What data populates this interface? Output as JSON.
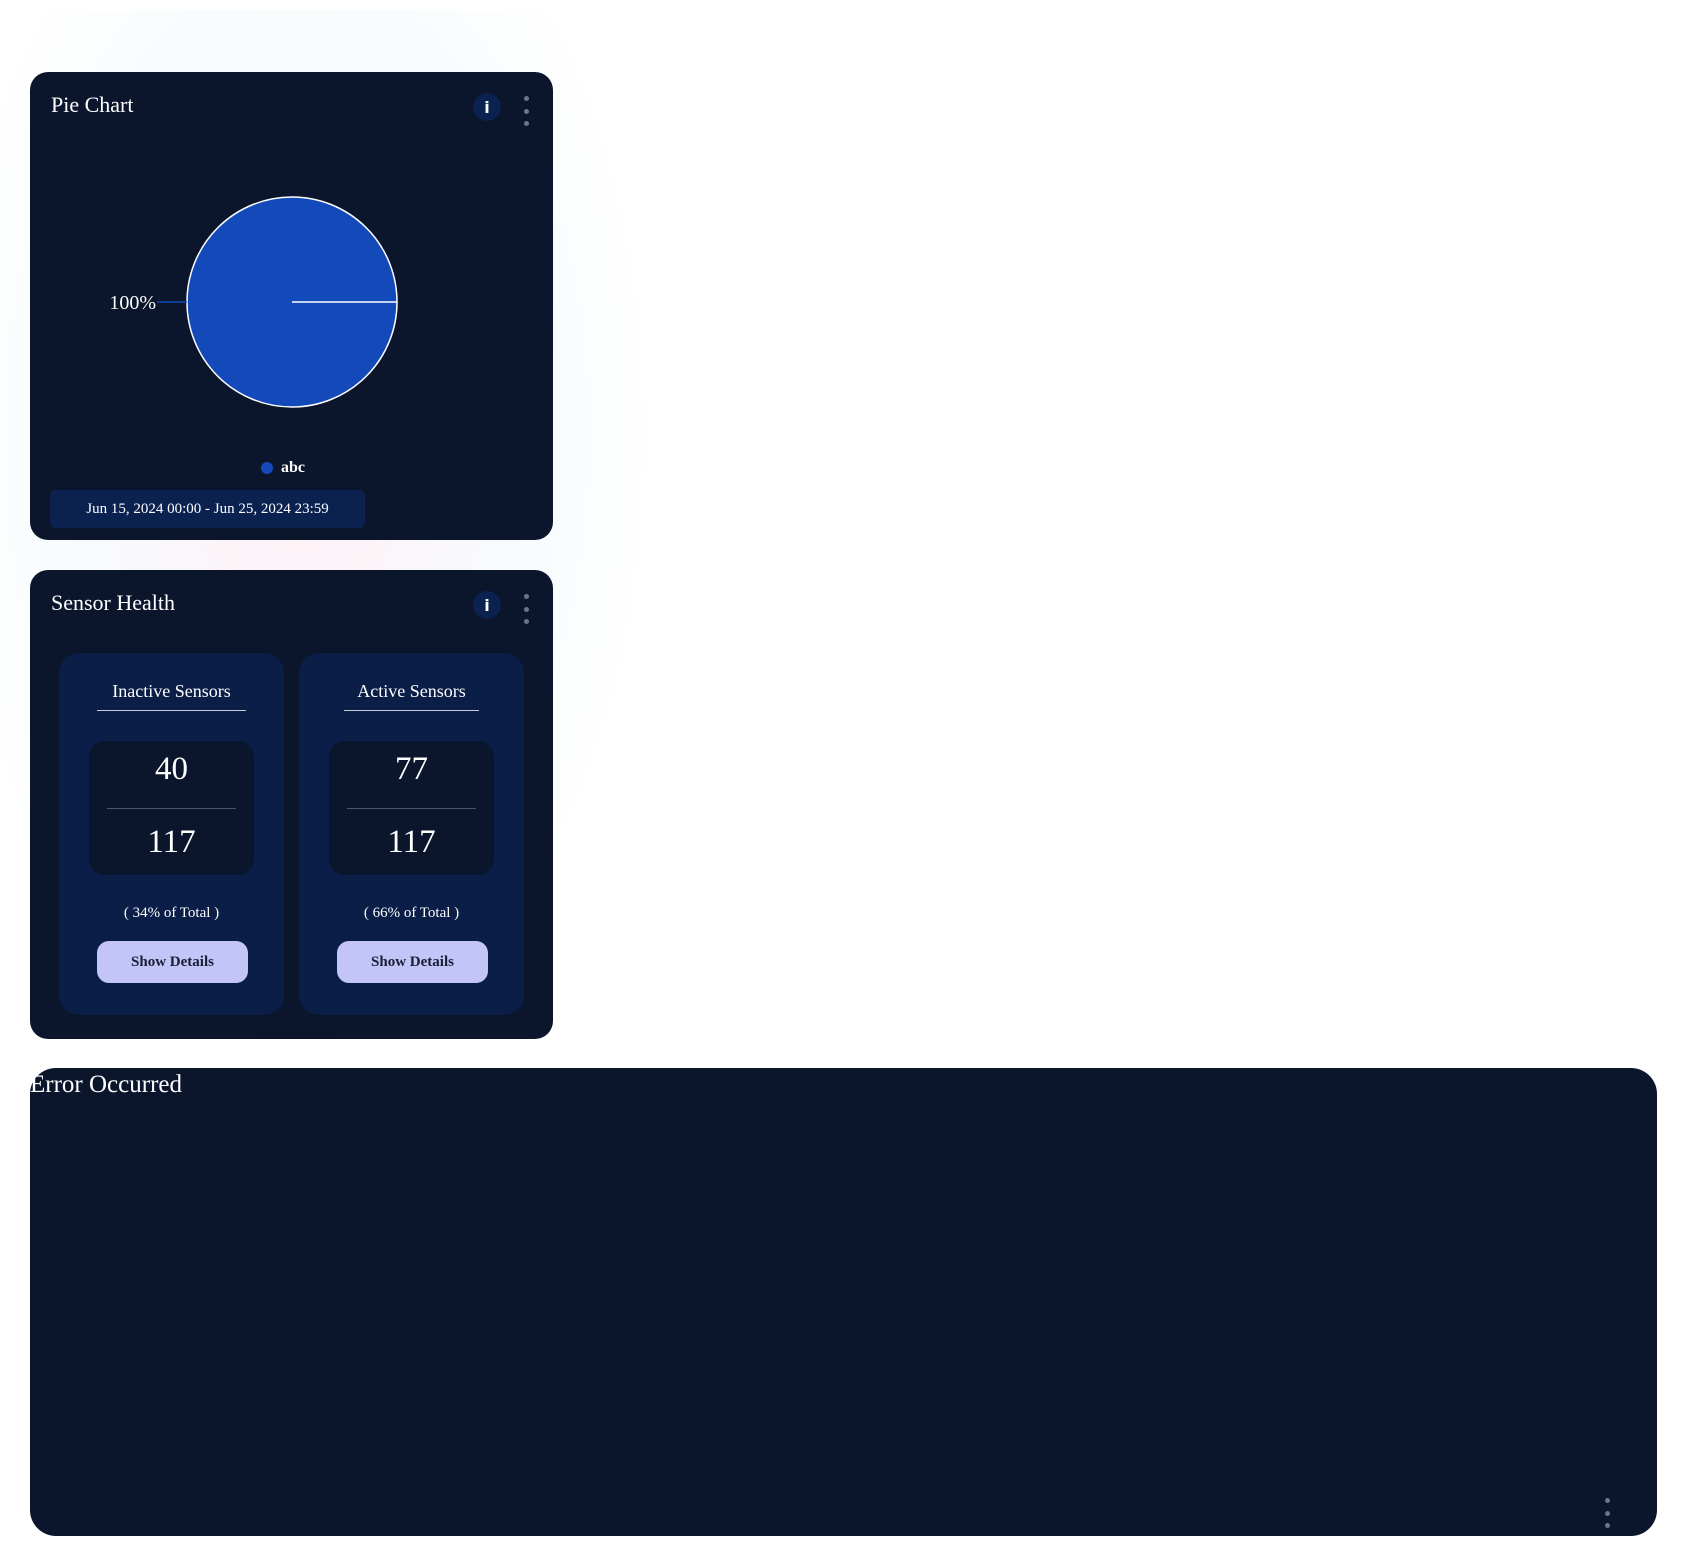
{
  "pie_card": {
    "title": "Pie Chart",
    "info_label": "i",
    "date_range": "Jun 15, 2024 00:00 - Jun 25, 2024 23:59"
  },
  "chart_data": {
    "type": "pie",
    "series": [
      {
        "name": "abc",
        "value": 100,
        "label": "100%",
        "color": "#1349b8"
      }
    ],
    "legend": {
      "placement": "bottom",
      "entries": [
        "abc"
      ]
    }
  },
  "sensor_card": {
    "title": "Sensor Health",
    "info_label": "i",
    "panels": [
      {
        "title": "Inactive Sensors",
        "count": "40",
        "total": "117",
        "percent_text": "( 34% of Total )",
        "button_label": "Show Details"
      },
      {
        "title": "Active Sensors",
        "count": "77",
        "total": "117",
        "percent_text": "( 66% of Total )",
        "button_label": "Show Details"
      }
    ]
  },
  "error_card": {
    "title": "Error Occurred"
  },
  "colors": {
    "card_bg": "#0b162d",
    "panel_bg": "#0b1e48",
    "button_bg": "#c3c4f8",
    "pie_slice": "#1349b8"
  },
  "icons": {
    "info": "info-icon",
    "menu": "kebab-menu-icon"
  }
}
